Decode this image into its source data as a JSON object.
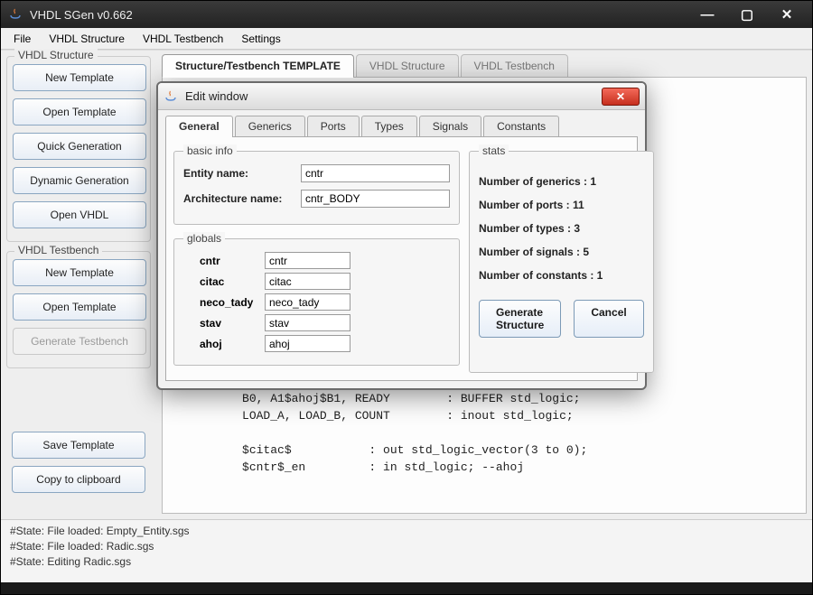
{
  "titlebar": {
    "title": "VHDL SGen     v0.662"
  },
  "menubar": {
    "items": [
      "File",
      "VHDL Structure",
      "VHDL Testbench",
      "Settings"
    ]
  },
  "sidebar": {
    "groups": [
      {
        "title": "VHDL Structure",
        "buttons": [
          "New Template",
          "Open Template",
          "Quick Generation",
          "Dynamic Generation",
          "Open VHDL"
        ]
      },
      {
        "title": "VHDL Testbench",
        "buttons": [
          "New Template",
          "Open Template",
          "Generate Testbench"
        ],
        "disabled": [
          2
        ]
      }
    ],
    "bottom_buttons": [
      "Save Template",
      "Copy to clipboard"
    ]
  },
  "main_tabs": {
    "items": [
      "Structure/Testbench TEMPLATE",
      "VHDL Structure",
      "VHDL Testbench"
    ],
    "active": 0
  },
  "editor_text": "--\n--\n--\n @e\n @a\n @e\n\n li\n us\n us\n\n er\n ge\n\n\n          );\nport (\n          CLK, RESET_$cntr$            : in std_logic; -- nojono\n          B0, A1$ahoj$B1, READY        : BUFFER std_logic;\n          LOAD_A, LOAD_B, COUNT        : inout std_logic;\n\n          $citac$           : out std_logic_vector(3 to 0);\n          $cntr$_en         : in std_logic; --ahoj",
  "status_lines": [
    "#State:     File loaded: Empty_Entity.sgs",
    "#State:     File loaded: Radic.sgs",
    "#State:     Editing Radic.sgs"
  ],
  "modal": {
    "title": "Edit window",
    "tabs": [
      "General",
      "Generics",
      "Ports",
      "Types",
      "Signals",
      "Constants"
    ],
    "active_tab": 0,
    "basic_info": {
      "legend": "basic info",
      "entity_label": "Entity name:",
      "entity_value": "cntr",
      "arch_label": "Architecture name:",
      "arch_value": "cntr_BODY"
    },
    "globals": {
      "legend": "globals",
      "rows": [
        {
          "label": "cntr",
          "value": "cntr"
        },
        {
          "label": "citac",
          "value": "citac"
        },
        {
          "label": "neco_tady",
          "value": "neco_tady"
        },
        {
          "label": "stav",
          "value": "stav"
        },
        {
          "label": "ahoj",
          "value": "ahoj"
        }
      ]
    },
    "stats": {
      "legend": "stats",
      "lines": [
        "Number of generics  : 1",
        "Number of ports  : 11",
        "Number of types   : 3",
        "Number of signals : 5",
        "Number of constants : 1"
      ]
    },
    "footer": {
      "generate": "Generate Structure",
      "cancel": "Cancel"
    }
  }
}
